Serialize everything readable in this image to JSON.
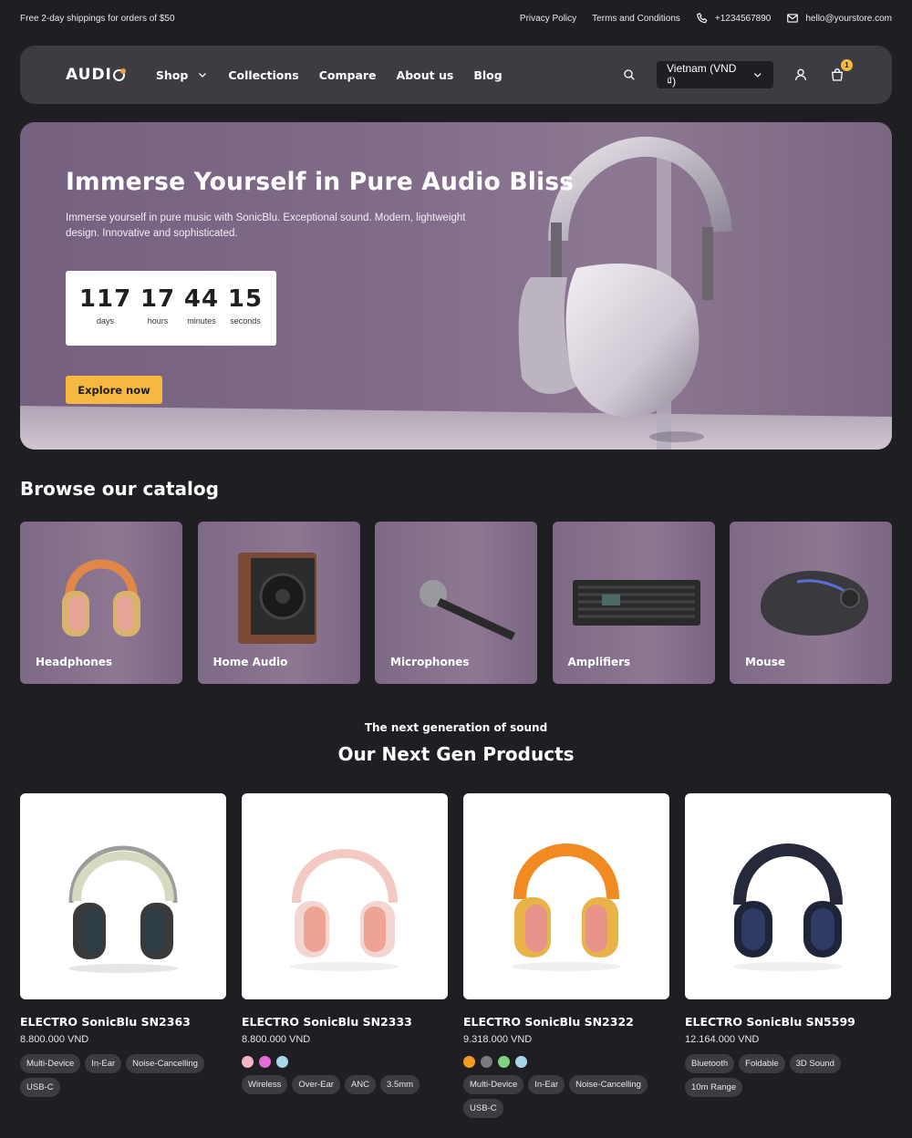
{
  "topbar": {
    "promo": "Free 2-day shippings for orders of $50",
    "privacy": "Privacy Policy",
    "terms": "Terms and Conditions",
    "phone": "+1234567890",
    "email": "hello@yourstore.com",
    "phone_icon": "phone-icon",
    "email_icon": "mail-icon"
  },
  "header": {
    "logo": "AUDI",
    "nav": [
      {
        "label": "Shop",
        "has_dropdown": true
      },
      {
        "label": "Collections"
      },
      {
        "label": "Compare"
      },
      {
        "label": "About us"
      },
      {
        "label": "Blog"
      }
    ],
    "currency": "Vietnam (VND ₫)",
    "cart_count": "1",
    "icons": [
      "search-icon",
      "user-icon",
      "cart-icon",
      "chevron-down-icon"
    ]
  },
  "hero": {
    "title": "Immerse Yourself in Pure Audio Bliss",
    "description": "Immerse yourself in pure music with SonicBlu. Exceptional sound. Modern, lightweight design. Innovative and sophisticated.",
    "countdown": [
      {
        "value": "117",
        "label": "days"
      },
      {
        "value": "17",
        "label": "hours"
      },
      {
        "value": "44",
        "label": "minutes"
      },
      {
        "value": "15",
        "label": "seconds"
      }
    ],
    "cta": "Explore now"
  },
  "catalog": {
    "title": "Browse our catalog",
    "items": [
      {
        "label": "Headphones",
        "icon": "headphones-icon"
      },
      {
        "label": "Home Audio",
        "icon": "speaker-icon"
      },
      {
        "label": "Microphones",
        "icon": "microphone-icon"
      },
      {
        "label": "Amplifiers",
        "icon": "amplifier-icon"
      },
      {
        "label": "Mouse",
        "icon": "mouse-icon"
      }
    ]
  },
  "next_gen": {
    "subtitle": "The next generation of sound",
    "title": "Our Next Gen Products",
    "products": [
      {
        "name": "ELECTRO SonicBlu SN2363",
        "price": "8.800.000 VND",
        "swatches": [],
        "tags": [
          "Multi-Device",
          "In-Ear",
          "Noise-Cancelling",
          "USB-C"
        ]
      },
      {
        "name": "ELECTRO SonicBlu SN2333",
        "price": "8.800.000 VND",
        "swatches": [
          "#f4b6c6",
          "#e46bd8",
          "#a9d6e8"
        ],
        "tags": [
          "Wireless",
          "Over-Ear",
          "ANC",
          "3.5mm"
        ]
      },
      {
        "name": "ELECTRO SonicBlu SN2322",
        "price": "9.318.000 VND",
        "swatches": [
          "#f29c1f",
          "#7b7b7e",
          "#7fd47f",
          "#a9d6e8"
        ],
        "tags": [
          "Multi-Device",
          "In-Ear",
          "Noise-Cancelling",
          "USB-C"
        ]
      },
      {
        "name": "ELECTRO SonicBlu SN5599",
        "price": "12.164.000 VND",
        "swatches": [],
        "tags": [
          "Bluetooth",
          "Foldable",
          "3D Sound",
          "10m Range"
        ]
      }
    ]
  },
  "colors": {
    "accent": "#f5b942",
    "background": "#1f1f23",
    "panel": "#3c3d42"
  }
}
